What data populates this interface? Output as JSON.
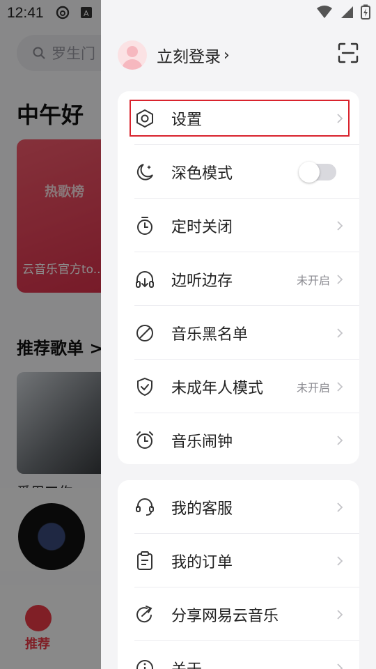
{
  "status_bar": {
    "time": "12:41"
  },
  "background": {
    "search_placeholder": "罗生门",
    "greeting": "中午好",
    "card_tag": "热歌榜",
    "card_subtitle": "云音乐官方to...",
    "section_title": "推荐歌单 >",
    "photo_caption": "爱用工作...",
    "tab_label": "推荐"
  },
  "drawer": {
    "login_label": "立刻登录",
    "login_chevron": "›",
    "menu_group_1": [
      {
        "label": "设置",
        "icon": "settings-hexagon-icon"
      },
      {
        "label": "深色模式",
        "icon": "moon-icon",
        "toggle": false
      },
      {
        "label": "定时关闭",
        "icon": "timer-icon"
      },
      {
        "label": "边听边存",
        "icon": "headphone-download-icon",
        "status": "未开启"
      },
      {
        "label": "音乐黑名单",
        "icon": "block-icon"
      },
      {
        "label": "未成年人模式",
        "icon": "shield-check-icon",
        "status": "未开启"
      },
      {
        "label": "音乐闹钟",
        "icon": "alarm-clock-icon"
      }
    ],
    "menu_group_2": [
      {
        "label": "我的客服",
        "icon": "headset-icon"
      },
      {
        "label": "我的订单",
        "icon": "clipboard-icon"
      },
      {
        "label": "分享网易云音乐",
        "icon": "share-icon"
      },
      {
        "label": "关于",
        "icon": "info-icon"
      }
    ]
  },
  "colors": {
    "accent": "#ea3a45",
    "highlight_box": "#d9232d"
  }
}
